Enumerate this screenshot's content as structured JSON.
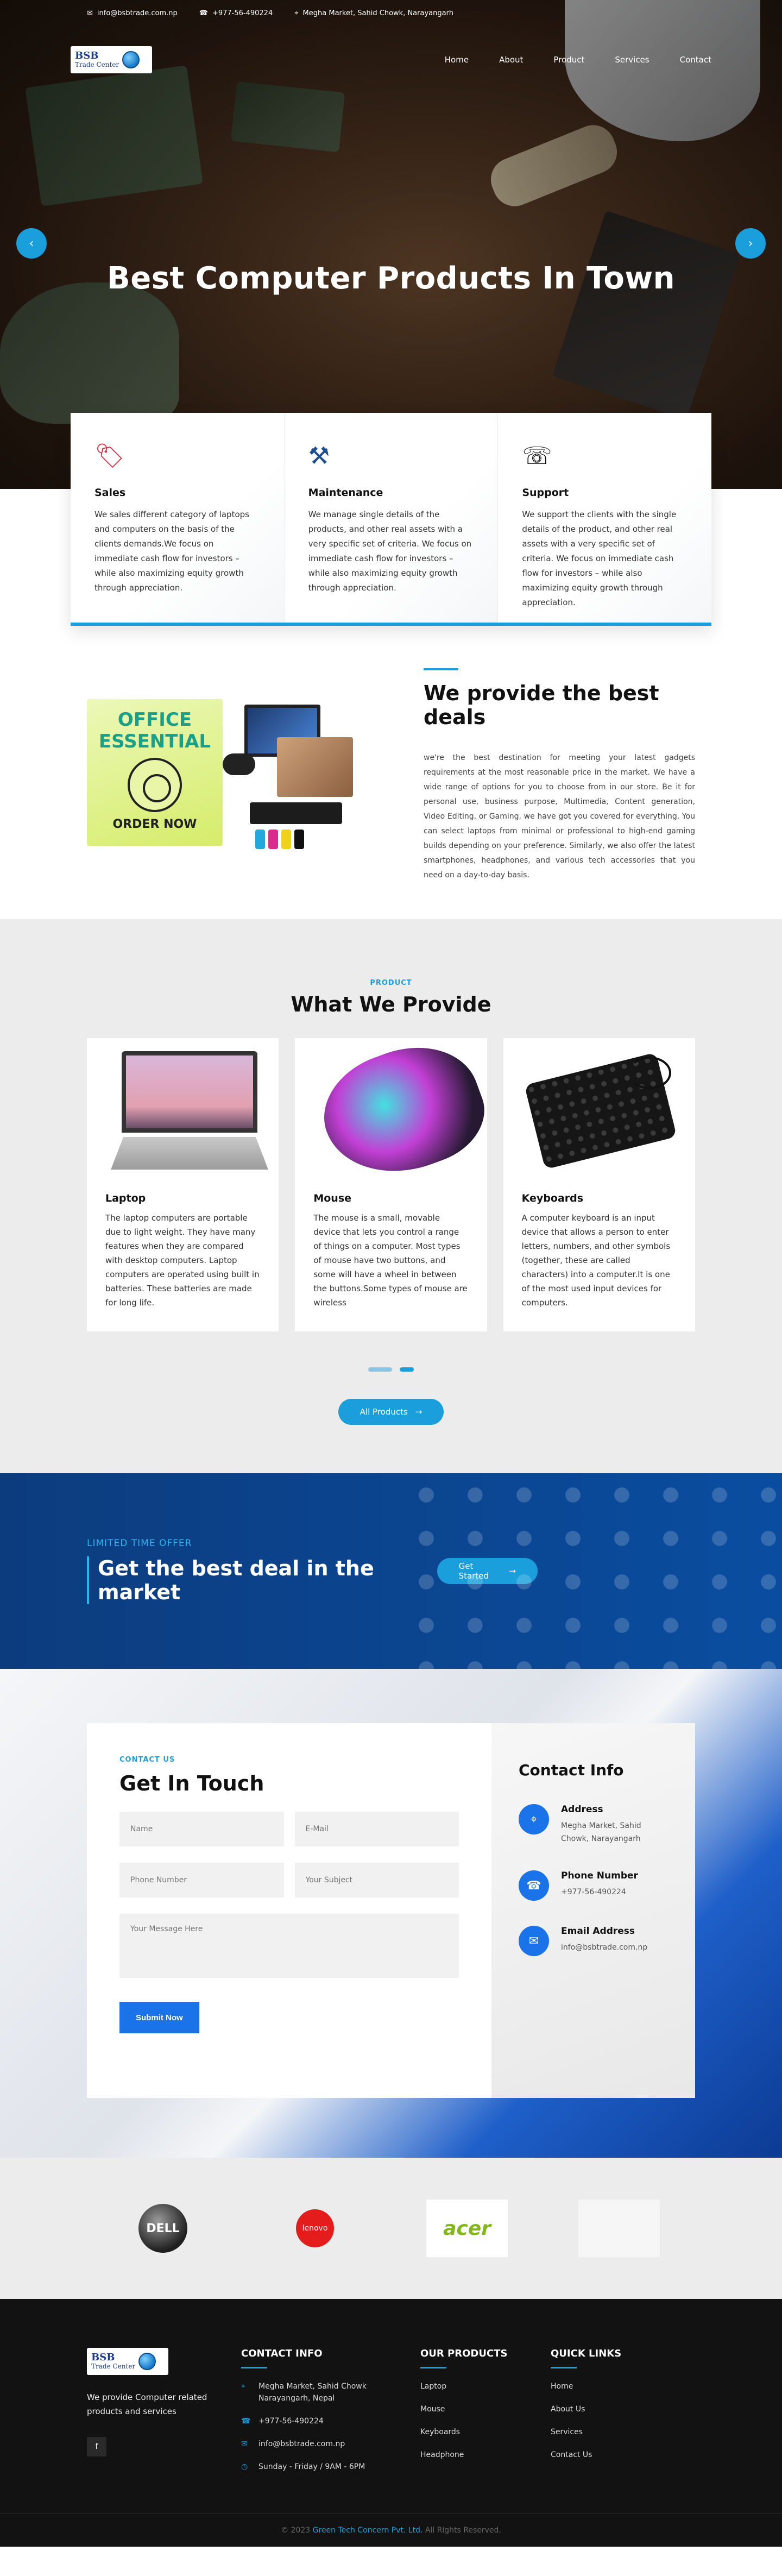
{
  "topbar": {
    "email": "info@bsbtrade.com.np",
    "phone": "+977-56-490224",
    "address": "Megha Market, Sahid Chowk, Narayangarh"
  },
  "logo": {
    "line1": "BSB",
    "line2": "Trade Center"
  },
  "nav": [
    "Home",
    "About",
    "Product",
    "Services",
    "Contact"
  ],
  "hero": {
    "title": "Best Computer Products In Town",
    "prev_icon": "arrow-left-icon",
    "next_icon": "arrow-right-icon"
  },
  "services": [
    {
      "icon": "sale-tag-icon",
      "title": "Sales",
      "text": "We sales different category of laptops and computers on the basis of the clients demands.We focus on immediate cash flow for investors – while also maximizing equity growth through appreciation."
    },
    {
      "icon": "tools-icon",
      "title": "Maintenance",
      "text": "We manage single details of the products, and other real assets with a very specific set of criteria. We focus on immediate cash flow for investors – while also maximizing equity growth through appreciation."
    },
    {
      "icon": "support-person-icon",
      "title": "Support",
      "text": "We support the clients with the single details of the product, and other real assets with a very specific set of criteria. We focus on immediate cash flow for investors – while also maximizing equity growth through appreciation."
    }
  ],
  "deals": {
    "promo_title": "OFFICE ESSENTIAL",
    "promo_cta": "ORDER NOW",
    "title": "We provide the best deals",
    "text": "we're the best destination for meeting your latest gadgets requirements at the most reasonable price in the market. We have a wide range of options for you to choose from in our store. Be it for personal use, business purpose, Multimedia, Content generation, Video Editing, or Gaming, we have got you covered for everything. You can select laptops from minimal or professional to high-end gaming builds depending on your preference. Similarly, we also offer the latest smartphones, headphones, and various tech accessories that you need on a day-to-day basis."
  },
  "products": {
    "kicker": "PRODUCT",
    "title": "What We Provide",
    "items": [
      {
        "title": "Laptop",
        "text": "The laptop computers are portable due to light weight. They have many features when they are compared with desktop computers. Laptop computers are operated using built in batteries. These batteries are made for long life."
      },
      {
        "title": "Mouse",
        "text": "The mouse is a small, movable device that lets you control a range of things on a computer. Most types of mouse have two buttons, and some will have a wheel in between the buttons.Some types of mouse are wireless"
      },
      {
        "title": "Keyboards",
        "text": "A computer keyboard is an input device that allows a person to enter letters, numbers, and other symbols (together, these are called characters) into a computer.It is one of the most used input devices for computers."
      }
    ],
    "button": "All Products"
  },
  "offer": {
    "kicker": "LIMITED TIME OFFER",
    "title": "Get the best deal in the market",
    "button": "Get Started"
  },
  "contact": {
    "kicker": "CONTACT US",
    "title": "Get In Touch",
    "placeholders": {
      "name": "Name",
      "email": "E-Mail",
      "phone": "Phone Number",
      "subject": "Your Subject",
      "message": "Your Message Here"
    },
    "submit": "Submit Now",
    "info_title": "Contact Info",
    "info": [
      {
        "icon": "location-pin-icon",
        "label": "Address",
        "value": "Megha Market, Sahid Chowk, Narayangarh"
      },
      {
        "icon": "phone-icon",
        "label": "Phone Number",
        "value": "+977-56-490224"
      },
      {
        "icon": "email-icon",
        "label": "Email Address",
        "value": "info@bsbtrade.com.np"
      }
    ]
  },
  "brands": [
    "DELL",
    "lenovo",
    "acer",
    ""
  ],
  "footer": {
    "about": "We provide Computer related products and services",
    "social": "f",
    "contact_title": "CONTACT INFO",
    "contact": [
      {
        "icon": "location-pin-icon",
        "text": "Megha Market, Sahid Chowk Narayangarh, Nepal"
      },
      {
        "icon": "phone-icon",
        "text": "+977-56-490224"
      },
      {
        "icon": "email-icon",
        "text": "info@bsbtrade.com.np"
      },
      {
        "icon": "clock-icon",
        "text": "Sunday - Friday / 9AM - 6PM"
      }
    ],
    "products_title": "OUR PRODUCTS",
    "products": [
      "Laptop",
      "Mouse",
      "Keyboards",
      "Headphone"
    ],
    "links_title": "QUICK LINKS",
    "links": [
      "Home",
      "About Us",
      "Services",
      "Contact Us"
    ],
    "copyright_prefix": "© 2023",
    "copyright_company": "Green Tech Concern Pvt. Ltd.",
    "copyright_suffix": "All Rights Reserved."
  },
  "colors": {
    "accent": "#1a9fdc",
    "primary_button": "#1a73e8",
    "offer_bg": "#0a4da0",
    "footer_bg": "#121212"
  }
}
